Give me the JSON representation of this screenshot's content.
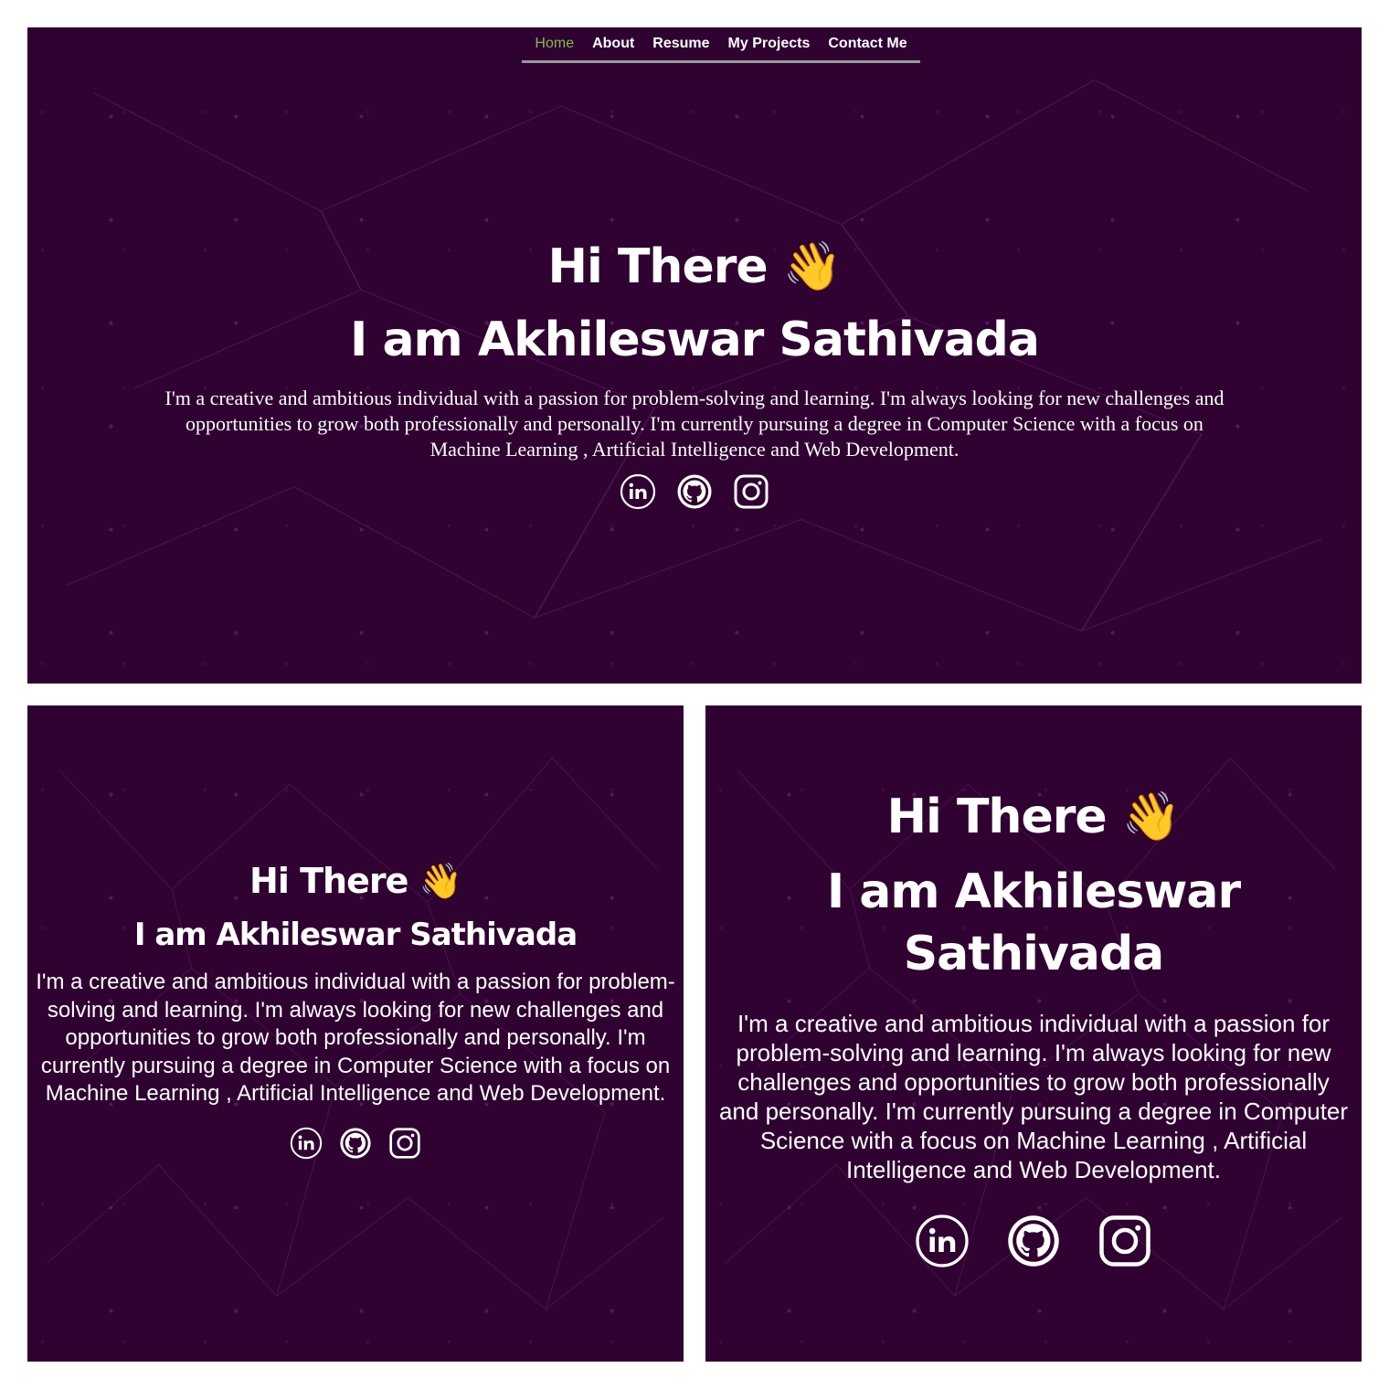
{
  "nav": {
    "items": [
      "Home",
      "About",
      "Resume",
      "My Projects",
      "Contact Me"
    ]
  },
  "hero": {
    "greeting": "Hi There",
    "wave_emoji": "👋",
    "name_line": "I am Akhileswar Sathivada",
    "name_line_split": [
      "I am Akhileswar",
      "Sathivada"
    ],
    "bio": "I'm a creative and ambitious individual with a passion for problem-solving and learning. I'm always looking for new challenges and opportunities to grow both professionally and personally. I'm currently pursuing a degree in Computer Science with a focus on Machine Learning , Artificial Intelligence and Web Development."
  },
  "socials": [
    {
      "icon": "linkedin-icon"
    },
    {
      "icon": "github-icon"
    },
    {
      "icon": "instagram-icon"
    }
  ],
  "colors": {
    "background": "#2f0231",
    "active_nav": "#84b84c",
    "text": "#ffffff",
    "nav_underline": "#9a9a9a"
  }
}
